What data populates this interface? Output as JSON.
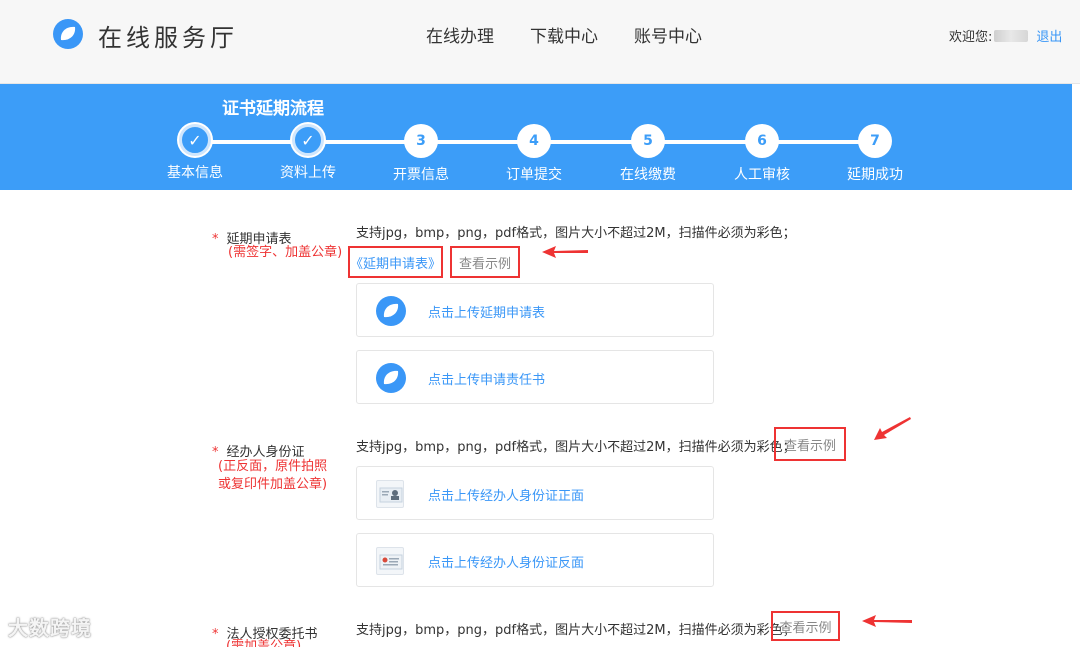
{
  "header": {
    "brand": "在线服务厅",
    "nav": [
      "在线办理",
      "下载中心",
      "账号中心"
    ],
    "welcome": "欢迎您:",
    "logout": "退出"
  },
  "banner": {
    "title": "证书延期流程",
    "steps": [
      {
        "num": "✓",
        "label": "基本信息",
        "done": true
      },
      {
        "num": "✓",
        "label": "资料上传",
        "done": true
      },
      {
        "num": "3",
        "label": "开票信息",
        "done": false
      },
      {
        "num": "4",
        "label": "订单提交",
        "done": false
      },
      {
        "num": "5",
        "label": "在线缴费",
        "done": false
      },
      {
        "num": "6",
        "label": "人工审核",
        "done": false
      },
      {
        "num": "7",
        "label": "延期成功",
        "done": false
      }
    ]
  },
  "sections": {
    "extension": {
      "label": "延期申请表",
      "note": "(需签字、加盖公章)",
      "hint": "支持jpg，bmp，png，pdf格式，图片大小不超过2M，扫描件必须为彩色；",
      "link": "《延期申请表》",
      "example": "查看示例",
      "uploads": [
        "点击上传延期申请表",
        "点击上传申请责任书"
      ]
    },
    "agent_id": {
      "label": "经办人身份证",
      "note_lines": [
        "(正反面，原件拍照",
        "或复印件加盖公章)"
      ],
      "hint": "支持jpg，bmp，png，pdf格式，图片大小不超过2M，扫描件必须为彩色；",
      "example": "查看示例",
      "uploads": [
        "点击上传经办人身份证正面",
        "点击上传经办人身份证反面"
      ]
    },
    "authorization": {
      "label": "法人授权委托书",
      "note": "(需加盖公章)",
      "hint": "支持jpg，bmp，png，pdf格式，图片大小不超过2M，扫描件必须为彩色；",
      "example": "查看示例"
    }
  },
  "watermark": "大数跨境",
  "colors": {
    "primary": "#3c9df8",
    "link": "#3a97f7",
    "highlight": "#e33333"
  }
}
